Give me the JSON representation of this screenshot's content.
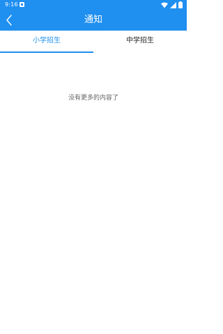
{
  "status_bar": {
    "time": "9:16",
    "icons": [
      "notification-icon",
      "wifi-icon",
      "signal-icon",
      "battery-icon"
    ]
  },
  "header": {
    "title": "通知",
    "back_icon": "chevron-left-icon",
    "background_color": "#1f8ff0"
  },
  "tabs": [
    {
      "label": "小学招生",
      "selected": true
    },
    {
      "label": "中学招生",
      "selected": false
    }
  ],
  "content": {
    "empty_message": "没有更多的内容了"
  },
  "colors": {
    "accent": "#1f8ff0",
    "tab_inactive": "#222222",
    "muted_text": "#666666"
  }
}
